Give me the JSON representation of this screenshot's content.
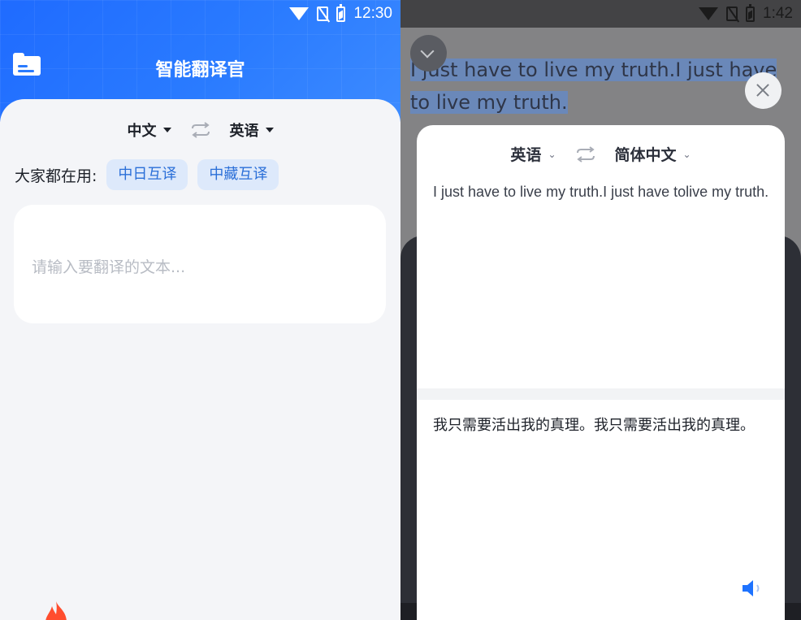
{
  "left": {
    "status": {
      "time": "12:30"
    },
    "header": {
      "title": "智能翻译官"
    },
    "languages": {
      "source": "中文",
      "target": "英语"
    },
    "popular": {
      "label": "大家都在用:",
      "chips": [
        "中日互译",
        "中藏互译"
      ]
    },
    "input": {
      "placeholder": "请输入要翻译的文本..."
    }
  },
  "right": {
    "status": {
      "time": "1:42"
    },
    "selected_text": "I just have to live my truth.I just have to live my truth.",
    "languages": {
      "source": "英语",
      "target": "简体中文"
    },
    "source_text": "I just have to live my truth.I just have tolive my truth.",
    "translation": "我只需要活出我的真理。我只需要活出我的真理。"
  },
  "colors": {
    "accent": "#2a7bff",
    "chip_bg": "#dde9fb",
    "chip_text": "#2a6fd8",
    "speaker": "#1e73ff"
  },
  "icons": {
    "left_header": "folder-icon",
    "swap": "swap-icon",
    "close": "close-icon",
    "collapse": "chevron-down-icon",
    "speaker": "speaker-icon",
    "hot": "flame-icon"
  }
}
